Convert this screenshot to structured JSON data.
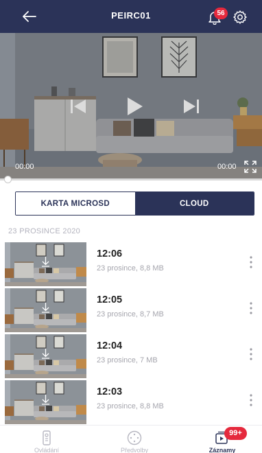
{
  "header": {
    "title": "PEIRC01",
    "notification_count": "56"
  },
  "player": {
    "current_time": "00:00",
    "end_time": "00:00",
    "progress": 0
  },
  "tabs": [
    {
      "label": "KARTA MICROSD",
      "active": false
    },
    {
      "label": "CLOUD",
      "active": true
    }
  ],
  "recordings": {
    "date_header": "23 PROSINCE 2020",
    "items": [
      {
        "time": "12:06",
        "meta": "23 prosince, 8,8 MB"
      },
      {
        "time": "12:05",
        "meta": "23 prosince, 8,7 MB"
      },
      {
        "time": "12:04",
        "meta": "23 prosince, 7 MB"
      },
      {
        "time": "12:03",
        "meta": "23 prosince, 8,8 MB"
      }
    ]
  },
  "bottom_nav": {
    "items": [
      {
        "label": "Ovládání",
        "icon": "remote-icon",
        "active": false
      },
      {
        "label": "Předvolby",
        "icon": "presets-icon",
        "active": false
      },
      {
        "label": "Záznamy",
        "icon": "recordings-icon",
        "active": true
      }
    ],
    "recordings_badge": "99+"
  },
  "colors": {
    "header_bg": "#2b3358",
    "accent": "#2b3358",
    "badge": "#e5293d"
  }
}
